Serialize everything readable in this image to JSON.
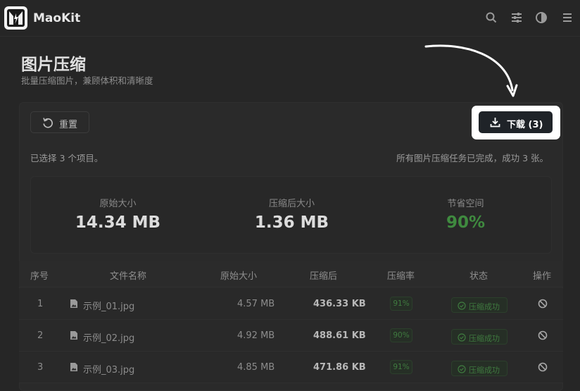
{
  "header": {
    "brand": "MaoKit",
    "icons": [
      "search-icon",
      "sliders-icon",
      "contrast-icon",
      "menu-icon"
    ]
  },
  "page": {
    "title": "图片压缩",
    "subtitle": "批量压缩图片，兼顾体积和清晰度"
  },
  "toolbar": {
    "reset_label": "重置",
    "download_label": "下载 (3)"
  },
  "status": {
    "selected_text": "已选择 3 个项目。",
    "done_text": "所有图片压缩任务已完成，成功 3 张。"
  },
  "stats": {
    "original_label": "原始大小",
    "original_value": "14.34 MB",
    "compressed_label": "压缩后大小",
    "compressed_value": "1.36 MB",
    "saved_label": "节省空间",
    "saved_value": "90%"
  },
  "table": {
    "headers": [
      "序号",
      "文件名称",
      "原始大小",
      "压缩后",
      "压缩率",
      "状态",
      "操作"
    ],
    "rows": [
      {
        "index": "1",
        "name": "示例_01.jpg",
        "original": "4.57 MB",
        "compressed": "436.33 KB",
        "rate": "91%",
        "status": "压缩成功"
      },
      {
        "index": "2",
        "name": "示例_02.jpg",
        "original": "4.92 MB",
        "compressed": "488.61 KB",
        "rate": "90%",
        "status": "压缩成功"
      },
      {
        "index": "3",
        "name": "示例_03.jpg",
        "original": "4.85 MB",
        "compressed": "471.86 KB",
        "rate": "91%",
        "status": "压缩成功"
      }
    ]
  },
  "colors": {
    "background": "#262626",
    "accent_dark": "#1f2328",
    "success_green": "#3f8a3f",
    "highlight": "#ffffff"
  }
}
